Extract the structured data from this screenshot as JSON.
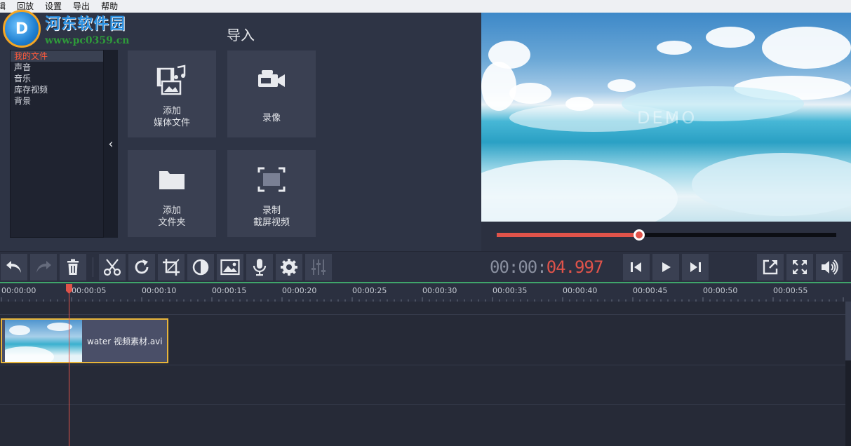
{
  "menu": [
    "辑",
    "回放",
    "设置",
    "导出",
    "帮助"
  ],
  "watermark": {
    "logo": "D",
    "title": "河东软件园",
    "url": "www.pc0359.cn"
  },
  "import": {
    "title": "导入",
    "categories": [
      "我的文件",
      "声音",
      "音乐",
      "库存视频",
      "背景"
    ],
    "collapse_glyph": "‹",
    "tiles": [
      {
        "label": "添加\n媒体文件",
        "icon": "add-media-icon"
      },
      {
        "label": "录像",
        "icon": "camera-icon"
      },
      {
        "label": "添加\n文件夹",
        "icon": "folder-icon"
      },
      {
        "label": "录制\n截屏视频",
        "icon": "screen-capture-icon"
      }
    ]
  },
  "preview": {
    "watermark_text": "DEMO"
  },
  "playback": {
    "progress": 0.42,
    "timecode_dim": "00:00:",
    "timecode_hot": "04.997"
  },
  "timeline": {
    "ticks": [
      "00:00:00",
      "00:00:05",
      "00:00:10",
      "00:00:15",
      "00:00:20",
      "00:00:25",
      "00:00:30",
      "00:00:35",
      "00:00:40",
      "00:00:45",
      "00:00:50",
      "00:00:55"
    ],
    "clip_label": "water 视频素材.avi"
  },
  "colors": {
    "accent": "#e0534a",
    "clip_border": "#e8b53a",
    "ruler_line": "#3fa56a",
    "active_category": "#ff5a3c"
  }
}
